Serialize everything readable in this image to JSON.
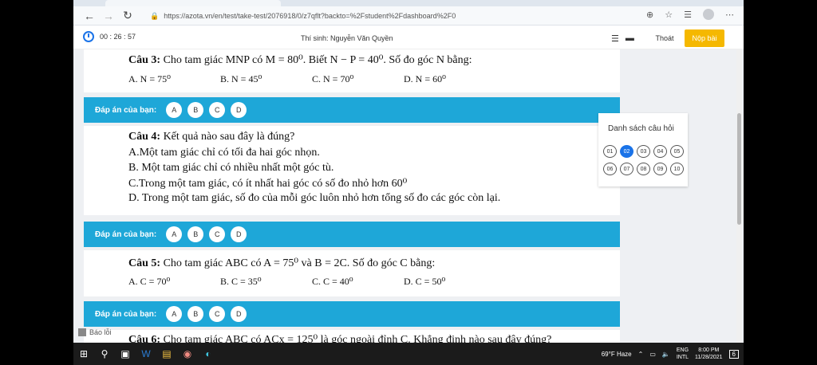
{
  "browser": {
    "url": "https://azota.vn/en/test/take-test/2076918/0/z7qflt?backto=%2Fstudent%2Fdashboard%2F0",
    "back_icon": "back-arrow-icon",
    "forward_icon": "forward-arrow-icon",
    "reload_icon": "reload-icon"
  },
  "header": {
    "timer": "00 : 26 : 57",
    "student": "Thí sinh: Nguyễn Văn Quyền",
    "exit_label": "Thoát",
    "submit_label": "Nộp bài",
    "submit_color": "#f5b800"
  },
  "answer_label": "Đáp án của bạn:",
  "answer_options": [
    "A",
    "B",
    "C",
    "D"
  ],
  "accent_color": "#1ea7d8",
  "questions": [
    {
      "title": "Câu 3:",
      "text": "Cho tam giác MNP có M = 80⁰. Biết N − P = 40⁰. Số đo góc N bằng:",
      "options": [
        "A. N = 75⁰",
        "B. N = 45⁰",
        "C. N = 70⁰",
        "D. N = 60⁰"
      ]
    },
    {
      "title": "Câu 4:",
      "text": "Kết quả nào sau đây là đúng?",
      "lines": [
        "A.Một tam giác chỉ có tối đa hai góc nhọn.",
        "B. Một tam giác chỉ có nhiều nhất một góc tù.",
        "C.Trong một tam giác, có ít nhất hai góc có số đo nhỏ hơn 60⁰",
        "D. Trong một tam giác, số đo của mỗi góc luôn nhỏ hơn tổng số đo các góc còn lại."
      ]
    },
    {
      "title": "Câu 5:",
      "text": "Cho tam giác ABC có A = 75⁰ và B = 2C. Số đo góc C bằng:",
      "options": [
        "A. C = 70⁰",
        "B. C = 35⁰",
        "C. C = 40⁰",
        "D. C = 50⁰"
      ]
    },
    {
      "title": "Câu 6:",
      "text": "Cho tam giác ABC có ACx = 125⁰ là góc ngoài đỉnh C. Khẳng định nào sau đây đúng?"
    }
  ],
  "panel": {
    "title": "Danh sách câu hỏi",
    "numbers": [
      "01",
      "02",
      "03",
      "04",
      "05",
      "06",
      "07",
      "08",
      "09",
      "10"
    ],
    "active": "02"
  },
  "report_label": "Báo lỗi",
  "taskbar": {
    "weather": "69°F Haze",
    "lang_top": "ENG",
    "lang_bottom": "INTL",
    "time": "8:00 PM",
    "date": "11/28/2021",
    "notif_count": "6"
  }
}
